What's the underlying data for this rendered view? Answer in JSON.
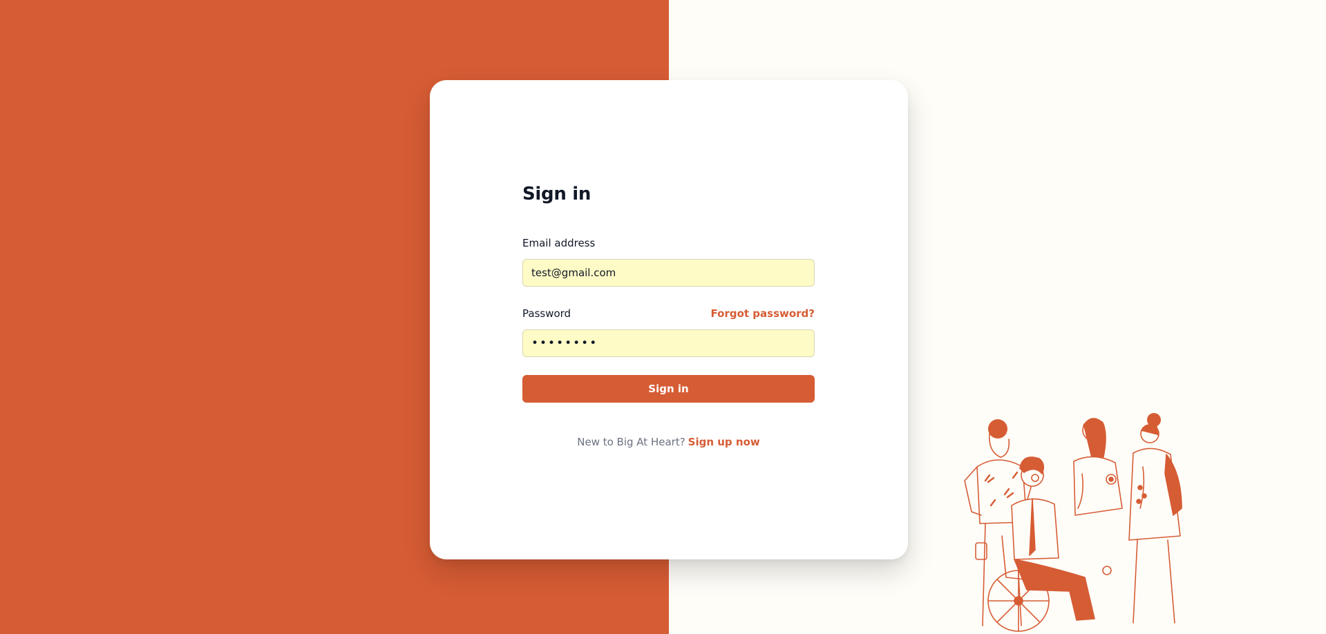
{
  "theme": {
    "accent": "#d65c34",
    "left_panel": "#d65c34",
    "right_panel": "#fffdf8",
    "input_fill": "#fefbc6"
  },
  "signin": {
    "title": "Sign in",
    "email": {
      "label": "Email address",
      "value": "test@gmail.com"
    },
    "password": {
      "label": "Password",
      "value": "••••••••",
      "forgot_label": "Forgot password?"
    },
    "submit_label": "Sign in",
    "signup": {
      "prompt": "New to Big At Heart?",
      "link_label": "Sign up now"
    }
  },
  "illustration": {
    "icon": "people-group-illustration"
  }
}
